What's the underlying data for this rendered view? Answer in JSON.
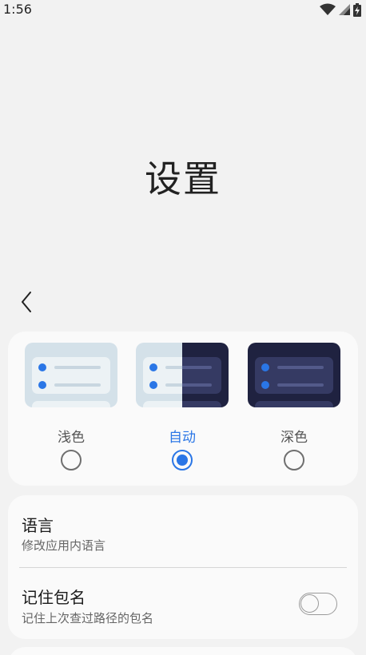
{
  "status_bar": {
    "time": "1:56"
  },
  "header": {
    "title": "设置"
  },
  "theme": {
    "options": [
      {
        "label": "浅色",
        "selected": false
      },
      {
        "label": "自动",
        "selected": true
      },
      {
        "label": "深色",
        "selected": false
      }
    ]
  },
  "settings": {
    "language": {
      "title": "语言",
      "subtitle": "修改应用内语言"
    },
    "remember_package": {
      "title": "记住包名",
      "subtitle": "记住上次查过路径的包名",
      "enabled": false
    }
  },
  "colors": {
    "accent": "#2a76e6",
    "background": "#f2f2f2",
    "card": "#fafafa",
    "light_preview": "#d4e1e9",
    "dark_preview": "#1f2240"
  }
}
